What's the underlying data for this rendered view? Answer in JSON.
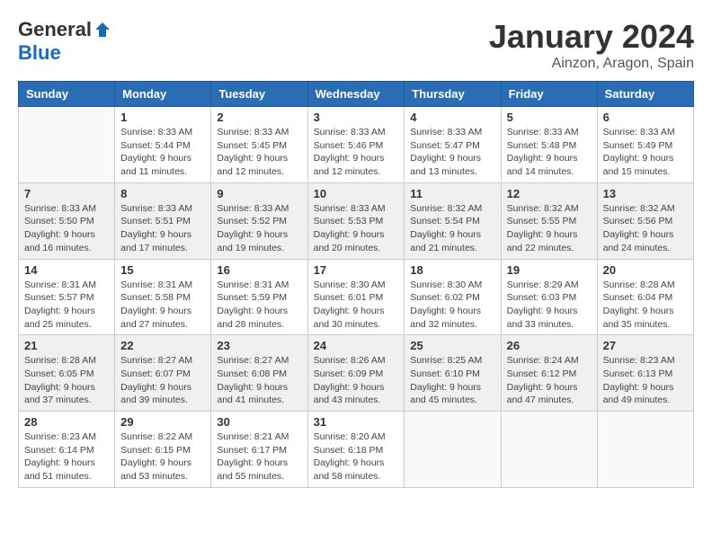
{
  "header": {
    "logo_general": "General",
    "logo_blue": "Blue",
    "month_title": "January 2024",
    "location": "Ainzon, Aragon, Spain"
  },
  "weekdays": [
    "Sunday",
    "Monday",
    "Tuesday",
    "Wednesday",
    "Thursday",
    "Friday",
    "Saturday"
  ],
  "weeks": [
    [
      {
        "day": "",
        "info": ""
      },
      {
        "day": "1",
        "info": "Sunrise: 8:33 AM\nSunset: 5:44 PM\nDaylight: 9 hours\nand 11 minutes."
      },
      {
        "day": "2",
        "info": "Sunrise: 8:33 AM\nSunset: 5:45 PM\nDaylight: 9 hours\nand 12 minutes."
      },
      {
        "day": "3",
        "info": "Sunrise: 8:33 AM\nSunset: 5:46 PM\nDaylight: 9 hours\nand 12 minutes."
      },
      {
        "day": "4",
        "info": "Sunrise: 8:33 AM\nSunset: 5:47 PM\nDaylight: 9 hours\nand 13 minutes."
      },
      {
        "day": "5",
        "info": "Sunrise: 8:33 AM\nSunset: 5:48 PM\nDaylight: 9 hours\nand 14 minutes."
      },
      {
        "day": "6",
        "info": "Sunrise: 8:33 AM\nSunset: 5:49 PM\nDaylight: 9 hours\nand 15 minutes."
      }
    ],
    [
      {
        "day": "7",
        "info": "Sunrise: 8:33 AM\nSunset: 5:50 PM\nDaylight: 9 hours\nand 16 minutes."
      },
      {
        "day": "8",
        "info": "Sunrise: 8:33 AM\nSunset: 5:51 PM\nDaylight: 9 hours\nand 17 minutes."
      },
      {
        "day": "9",
        "info": "Sunrise: 8:33 AM\nSunset: 5:52 PM\nDaylight: 9 hours\nand 19 minutes."
      },
      {
        "day": "10",
        "info": "Sunrise: 8:33 AM\nSunset: 5:53 PM\nDaylight: 9 hours\nand 20 minutes."
      },
      {
        "day": "11",
        "info": "Sunrise: 8:32 AM\nSunset: 5:54 PM\nDaylight: 9 hours\nand 21 minutes."
      },
      {
        "day": "12",
        "info": "Sunrise: 8:32 AM\nSunset: 5:55 PM\nDaylight: 9 hours\nand 22 minutes."
      },
      {
        "day": "13",
        "info": "Sunrise: 8:32 AM\nSunset: 5:56 PM\nDaylight: 9 hours\nand 24 minutes."
      }
    ],
    [
      {
        "day": "14",
        "info": "Sunrise: 8:31 AM\nSunset: 5:57 PM\nDaylight: 9 hours\nand 25 minutes."
      },
      {
        "day": "15",
        "info": "Sunrise: 8:31 AM\nSunset: 5:58 PM\nDaylight: 9 hours\nand 27 minutes."
      },
      {
        "day": "16",
        "info": "Sunrise: 8:31 AM\nSunset: 5:59 PM\nDaylight: 9 hours\nand 28 minutes."
      },
      {
        "day": "17",
        "info": "Sunrise: 8:30 AM\nSunset: 6:01 PM\nDaylight: 9 hours\nand 30 minutes."
      },
      {
        "day": "18",
        "info": "Sunrise: 8:30 AM\nSunset: 6:02 PM\nDaylight: 9 hours\nand 32 minutes."
      },
      {
        "day": "19",
        "info": "Sunrise: 8:29 AM\nSunset: 6:03 PM\nDaylight: 9 hours\nand 33 minutes."
      },
      {
        "day": "20",
        "info": "Sunrise: 8:28 AM\nSunset: 6:04 PM\nDaylight: 9 hours\nand 35 minutes."
      }
    ],
    [
      {
        "day": "21",
        "info": "Sunrise: 8:28 AM\nSunset: 6:05 PM\nDaylight: 9 hours\nand 37 minutes."
      },
      {
        "day": "22",
        "info": "Sunrise: 8:27 AM\nSunset: 6:07 PM\nDaylight: 9 hours\nand 39 minutes."
      },
      {
        "day": "23",
        "info": "Sunrise: 8:27 AM\nSunset: 6:08 PM\nDaylight: 9 hours\nand 41 minutes."
      },
      {
        "day": "24",
        "info": "Sunrise: 8:26 AM\nSunset: 6:09 PM\nDaylight: 9 hours\nand 43 minutes."
      },
      {
        "day": "25",
        "info": "Sunrise: 8:25 AM\nSunset: 6:10 PM\nDaylight: 9 hours\nand 45 minutes."
      },
      {
        "day": "26",
        "info": "Sunrise: 8:24 AM\nSunset: 6:12 PM\nDaylight: 9 hours\nand 47 minutes."
      },
      {
        "day": "27",
        "info": "Sunrise: 8:23 AM\nSunset: 6:13 PM\nDaylight: 9 hours\nand 49 minutes."
      }
    ],
    [
      {
        "day": "28",
        "info": "Sunrise: 8:23 AM\nSunset: 6:14 PM\nDaylight: 9 hours\nand 51 minutes."
      },
      {
        "day": "29",
        "info": "Sunrise: 8:22 AM\nSunset: 6:15 PM\nDaylight: 9 hours\nand 53 minutes."
      },
      {
        "day": "30",
        "info": "Sunrise: 8:21 AM\nSunset: 6:17 PM\nDaylight: 9 hours\nand 55 minutes."
      },
      {
        "day": "31",
        "info": "Sunrise: 8:20 AM\nSunset: 6:18 PM\nDaylight: 9 hours\nand 58 minutes."
      },
      {
        "day": "",
        "info": ""
      },
      {
        "day": "",
        "info": ""
      },
      {
        "day": "",
        "info": ""
      }
    ]
  ]
}
